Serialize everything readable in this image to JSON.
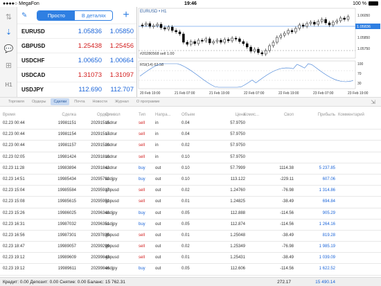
{
  "status": {
    "carrier": "MegaFon",
    "time": "19:46",
    "battery": "100 %"
  },
  "toolbar": {
    "simple": "Просто",
    "detailed": "В деталях"
  },
  "quotes": [
    {
      "symbol": "EURUSD",
      "bid": "1.05836",
      "ask": "1.05850",
      "bid_color": "#1a64d8",
      "ask_color": "#1a64d8"
    },
    {
      "symbol": "GBPUSD",
      "bid": "1.25438",
      "ask": "1.25456",
      "bid_color": "#d21d1d",
      "ask_color": "#d21d1d"
    },
    {
      "symbol": "USDCHF",
      "bid": "1.00650",
      "ask": "1.00664",
      "bid_color": "#1a64d8",
      "ask_color": "#1a64d8"
    },
    {
      "symbol": "USDCAD",
      "bid": "1.31073",
      "ask": "1.31097",
      "bid_color": "#d21d1d",
      "ask_color": "#d21d1d"
    },
    {
      "symbol": "USDJPY",
      "bid": "112.690",
      "ask": "112.707",
      "bid_color": "#1a64d8",
      "ask_color": "#1a64d8"
    }
  ],
  "chart": {
    "symbol": "EURUSD • H1",
    "price_label": "1.05836",
    "price_levels": [
      "1.06050",
      "1.05950",
      "1.05850",
      "1.05750"
    ],
    "order_label": "#20280568 sell 1.00",
    "rsi_label": "RSI(14) 62.58",
    "rsi_levels": [
      "100",
      "70",
      "30"
    ],
    "time_labels": [
      "20 Feb 19:00",
      "21 Feb 07:00",
      "21 Feb 19:00",
      "22 Feb 07:00",
      "22 Feb 19:00",
      "23 Feb 07:00",
      "23 Feb 19:00"
    ]
  },
  "tabs": [
    "Торговля",
    "Ордеры",
    "Сделки",
    "Почта",
    "Новости",
    "Журнал",
    "О программе"
  ],
  "columns": [
    "Время",
    "Сделка",
    "Ордер",
    "Символ",
    "Тип",
    "Напра...",
    "Объем",
    "Цена",
    "Комис...",
    "Своп",
    "Прибыль",
    "Комментарий"
  ],
  "deals": [
    {
      "time": "02.23 00:44",
      "deal": "19981151",
      "order": "20291515",
      "symbol": "usdrur",
      "type": "sell",
      "dir": "in",
      "vol": "0.04",
      "price": "57.9750",
      "swap": "",
      "profit": ""
    },
    {
      "time": "02.23 00:44",
      "deal": "19981154",
      "order": "20291517",
      "symbol": "usdrur",
      "type": "sell",
      "dir": "in",
      "vol": "0.04",
      "price": "57.9750",
      "swap": "",
      "profit": ""
    },
    {
      "time": "02.23 00:44",
      "deal": "19981157",
      "order": "20291520",
      "symbol": "usdrur",
      "type": "sell",
      "dir": "in",
      "vol": "0.02",
      "price": "57.9750",
      "swap": "",
      "profit": ""
    },
    {
      "time": "02.23 02:05",
      "deal": "19981424",
      "order": "20291810",
      "symbol": "usdrur",
      "type": "sell",
      "dir": "in",
      "vol": "0.10",
      "price": "57.9750",
      "swap": "",
      "profit": ""
    },
    {
      "time": "02.23 11:28",
      "deal": "19983894",
      "order": "20291842",
      "symbol": "usdrur",
      "type": "buy",
      "dir": "out",
      "vol": "0.10",
      "price": "57.7999",
      "swap": "1114.38",
      "profit": "5 237.85"
    },
    {
      "time": "02.23 14:51",
      "deal": "19985434",
      "order": "20295792",
      "symbol": "usdjpy",
      "type": "buy",
      "dir": "out",
      "vol": "0.10",
      "price": "113.122",
      "swap": "-229.11",
      "profit": "607.06"
    },
    {
      "time": "02.23 15:04",
      "deal": "19985584",
      "order": "20295917",
      "symbol": "gbpusd",
      "type": "sell",
      "dir": "out",
      "vol": "0.02",
      "price": "1.24760",
      "swap": "-76.98",
      "profit": "1 314.86"
    },
    {
      "time": "02.23 15:08",
      "deal": "19985615",
      "order": "20295951",
      "symbol": "gbpusd",
      "type": "sell",
      "dir": "out",
      "vol": "0.01",
      "price": "1.24825",
      "swap": "-38.49",
      "profit": "694.84"
    },
    {
      "time": "02.23 15:26",
      "deal": "19986025",
      "order": "20296348",
      "symbol": "usdjpy",
      "type": "buy",
      "dir": "out",
      "vol": "0.05",
      "price": "112.888",
      "swap": "-114.56",
      "profit": "905.29"
    },
    {
      "time": "02.23 16:31",
      "deal": "19987032",
      "order": "20296351",
      "symbol": "usdjpy",
      "type": "buy",
      "dir": "out",
      "vol": "0.05",
      "price": "112.874",
      "swap": "-114.56",
      "profit": "1 264.16"
    },
    {
      "time": "02.23 16:56",
      "deal": "19987301",
      "order": "20297835",
      "symbol": "gbpusd",
      "type": "sell",
      "dir": "out",
      "vol": "0.01",
      "price": "1.25048",
      "swap": "-38.49",
      "profit": "819.28"
    },
    {
      "time": "02.23 18:47",
      "deal": "19989057",
      "order": "20299299",
      "symbol": "gbpusd",
      "type": "sell",
      "dir": "out",
      "vol": "0.02",
      "price": "1.25349",
      "swap": "-76.98",
      "profit": "1 985.19"
    },
    {
      "time": "02.23 19:12",
      "deal": "19989609",
      "order": "20299843",
      "symbol": "gbpusd",
      "type": "sell",
      "dir": "out",
      "vol": "0.01",
      "price": "1.25431",
      "swap": "-38.49",
      "profit": "1 039.09"
    },
    {
      "time": "02.23 19:12",
      "deal": "19989611",
      "order": "20299846",
      "symbol": "usdjpy",
      "type": "buy",
      "dir": "out",
      "vol": "0.05",
      "price": "112.606",
      "swap": "-114.56",
      "profit": "1 622.52"
    }
  ],
  "footer": {
    "summary": "Кредит: 0.00 Депозит: 0.00 Снятие: 0.00 Баланс: 15 762.31",
    "swap_total": "272.17",
    "profit_total": "15 490.14"
  },
  "colors": {
    "accent": "#2f7fe2",
    "sell": "#d21d1d",
    "buy": "#1a64d8"
  }
}
